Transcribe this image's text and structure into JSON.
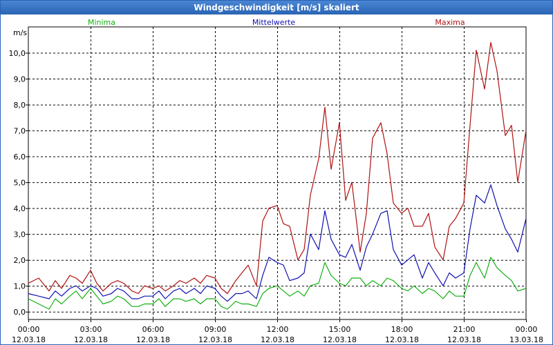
{
  "window": {
    "title": "Windgeschwindigkeit [m/s] skaliert"
  },
  "chart_data": {
    "type": "line",
    "title": "Windgeschwindigkeit [m/s] skaliert",
    "ylabel": "m/s",
    "ylim": [
      -0.3,
      11.0
    ],
    "xlim_hours": [
      0,
      24
    ],
    "y_ticks": [
      "0,0",
      "1,0",
      "2,0",
      "3,0",
      "4,0",
      "5,0",
      "6,0",
      "7,0",
      "8,0",
      "9,0",
      "10,0"
    ],
    "x_ticks": [
      {
        "time": "00:00",
        "date": "12.03.18"
      },
      {
        "time": "03:00",
        "date": "12.03.18"
      },
      {
        "time": "06:00",
        "date": "12.03.18"
      },
      {
        "time": "09:00",
        "date": "12.03.18"
      },
      {
        "time": "12:00",
        "date": "12.03.18"
      },
      {
        "time": "15:00",
        "date": "12.03.18"
      },
      {
        "time": "18:00",
        "date": "12.03.18"
      },
      {
        "time": "21:00",
        "date": "12.03.18"
      },
      {
        "time": "00:00",
        "date": "13.03.18"
      }
    ],
    "grid": true,
    "legend_position": "top",
    "series": [
      {
        "name": "Minima",
        "color": "#10b010",
        "points": [
          [
            0,
            0.5
          ],
          [
            0.5,
            0.3
          ],
          [
            1,
            0.1
          ],
          [
            1.3,
            0.5
          ],
          [
            1.6,
            0.3
          ],
          [
            2,
            0.6
          ],
          [
            2.3,
            0.8
          ],
          [
            2.6,
            0.5
          ],
          [
            3,
            0.9
          ],
          [
            3.3,
            0.6
          ],
          [
            3.6,
            0.3
          ],
          [
            4,
            0.4
          ],
          [
            4.3,
            0.6
          ],
          [
            4.6,
            0.5
          ],
          [
            5,
            0.2
          ],
          [
            5.3,
            0.2
          ],
          [
            5.6,
            0.3
          ],
          [
            6,
            0.3
          ],
          [
            6.3,
            0.5
          ],
          [
            6.6,
            0.2
          ],
          [
            7,
            0.5
          ],
          [
            7.3,
            0.5
          ],
          [
            7.6,
            0.4
          ],
          [
            8,
            0.5
          ],
          [
            8.3,
            0.3
          ],
          [
            8.6,
            0.5
          ],
          [
            9,
            0.5
          ],
          [
            9.3,
            0.2
          ],
          [
            9.6,
            0.1
          ],
          [
            10,
            0.4
          ],
          [
            10.3,
            0.3
          ],
          [
            10.6,
            0.3
          ],
          [
            11,
            0.2
          ],
          [
            11.3,
            0.7
          ],
          [
            11.6,
            0.9
          ],
          [
            12,
            1.0
          ],
          [
            12.3,
            0.8
          ],
          [
            12.6,
            0.6
          ],
          [
            13,
            0.8
          ],
          [
            13.3,
            0.6
          ],
          [
            13.6,
            1.0
          ],
          [
            14,
            1.1
          ],
          [
            14.3,
            1.9
          ],
          [
            14.6,
            1.4
          ],
          [
            15,
            1.1
          ],
          [
            15.3,
            1.0
          ],
          [
            15.6,
            1.3
          ],
          [
            16,
            1.3
          ],
          [
            16.3,
            1.0
          ],
          [
            16.6,
            1.2
          ],
          [
            17,
            1.0
          ],
          [
            17.3,
            1.3
          ],
          [
            17.6,
            1.2
          ],
          [
            18,
            0.9
          ],
          [
            18.3,
            0.8
          ],
          [
            18.6,
            1.0
          ],
          [
            19,
            0.7
          ],
          [
            19.3,
            0.9
          ],
          [
            19.6,
            0.8
          ],
          [
            20,
            0.5
          ],
          [
            20.3,
            0.8
          ],
          [
            20.6,
            0.6
          ],
          [
            21,
            0.6
          ],
          [
            21.3,
            1.4
          ],
          [
            21.6,
            1.9
          ],
          [
            22,
            1.3
          ],
          [
            22.3,
            2.1
          ],
          [
            22.6,
            1.7
          ],
          [
            23,
            1.4
          ],
          [
            23.3,
            1.2
          ],
          [
            23.6,
            0.8
          ],
          [
            24,
            0.9
          ]
        ]
      },
      {
        "name": "Mittelwerte",
        "color": "#1010b0",
        "points": [
          [
            0,
            0.7
          ],
          [
            0.5,
            0.6
          ],
          [
            1,
            0.5
          ],
          [
            1.3,
            0.8
          ],
          [
            1.6,
            0.6
          ],
          [
            2,
            0.9
          ],
          [
            2.3,
            1.0
          ],
          [
            2.6,
            0.8
          ],
          [
            3,
            1.0
          ],
          [
            3.3,
            0.9
          ],
          [
            3.6,
            0.6
          ],
          [
            4,
            0.7
          ],
          [
            4.3,
            0.9
          ],
          [
            4.6,
            0.8
          ],
          [
            5,
            0.5
          ],
          [
            5.3,
            0.5
          ],
          [
            5.6,
            0.6
          ],
          [
            6,
            0.6
          ],
          [
            6.3,
            0.8
          ],
          [
            6.6,
            0.5
          ],
          [
            7,
            0.8
          ],
          [
            7.3,
            0.9
          ],
          [
            7.6,
            0.7
          ],
          [
            8,
            0.9
          ],
          [
            8.3,
            0.7
          ],
          [
            8.6,
            1.0
          ],
          [
            9,
            0.9
          ],
          [
            9.3,
            0.6
          ],
          [
            9.6,
            0.4
          ],
          [
            10,
            0.7
          ],
          [
            10.3,
            0.7
          ],
          [
            10.6,
            0.8
          ],
          [
            11,
            0.5
          ],
          [
            11.3,
            1.4
          ],
          [
            11.6,
            2.1
          ],
          [
            12,
            1.9
          ],
          [
            12.3,
            1.8
          ],
          [
            12.6,
            1.2
          ],
          [
            13,
            1.3
          ],
          [
            13.3,
            1.5
          ],
          [
            13.6,
            3.0
          ],
          [
            14,
            2.4
          ],
          [
            14.3,
            3.9
          ],
          [
            14.6,
            2.8
          ],
          [
            15,
            2.2
          ],
          [
            15.3,
            2.1
          ],
          [
            15.6,
            2.6
          ],
          [
            16,
            1.6
          ],
          [
            16.3,
            2.5
          ],
          [
            16.6,
            3.0
          ],
          [
            17,
            3.8
          ],
          [
            17.3,
            3.9
          ],
          [
            17.6,
            2.4
          ],
          [
            18,
            1.8
          ],
          [
            18.3,
            2.0
          ],
          [
            18.6,
            2.2
          ],
          [
            19,
            1.3
          ],
          [
            19.3,
            1.9
          ],
          [
            19.6,
            1.5
          ],
          [
            20,
            1.0
          ],
          [
            20.3,
            1.5
          ],
          [
            20.6,
            1.3
          ],
          [
            21,
            1.5
          ],
          [
            21.3,
            3.2
          ],
          [
            21.6,
            4.5
          ],
          [
            22,
            4.2
          ],
          [
            22.3,
            4.9
          ],
          [
            22.6,
            4.1
          ],
          [
            23,
            3.2
          ],
          [
            23.3,
            2.8
          ],
          [
            23.6,
            2.3
          ],
          [
            24,
            3.6
          ]
        ]
      },
      {
        "name": "Maxima",
        "color": "#b01010",
        "points": [
          [
            0,
            1.1
          ],
          [
            0.5,
            1.3
          ],
          [
            1,
            0.8
          ],
          [
            1.3,
            1.2
          ],
          [
            1.6,
            0.9
          ],
          [
            2,
            1.4
          ],
          [
            2.3,
            1.3
          ],
          [
            2.6,
            1.1
          ],
          [
            3,
            1.6
          ],
          [
            3.3,
            1.1
          ],
          [
            3.6,
            0.8
          ],
          [
            4,
            1.1
          ],
          [
            4.3,
            1.2
          ],
          [
            4.6,
            1.1
          ],
          [
            5,
            0.8
          ],
          [
            5.3,
            0.7
          ],
          [
            5.6,
            1.0
          ],
          [
            6,
            0.9
          ],
          [
            6.3,
            1.0
          ],
          [
            6.6,
            0.8
          ],
          [
            7,
            1.0
          ],
          [
            7.3,
            1.2
          ],
          [
            7.6,
            1.1
          ],
          [
            8,
            1.3
          ],
          [
            8.3,
            1.1
          ],
          [
            8.6,
            1.4
          ],
          [
            9,
            1.3
          ],
          [
            9.3,
            0.9
          ],
          [
            9.6,
            0.7
          ],
          [
            10,
            1.2
          ],
          [
            10.3,
            1.5
          ],
          [
            10.6,
            1.8
          ],
          [
            11,
            1.0
          ],
          [
            11.3,
            3.5
          ],
          [
            11.6,
            4.0
          ],
          [
            12,
            4.1
          ],
          [
            12.3,
            3.4
          ],
          [
            12.6,
            3.3
          ],
          [
            13,
            2.0
          ],
          [
            13.3,
            2.4
          ],
          [
            13.6,
            4.5
          ],
          [
            14,
            5.9
          ],
          [
            14.3,
            7.9
          ],
          [
            14.6,
            5.5
          ],
          [
            15,
            7.3
          ],
          [
            15.3,
            4.3
          ],
          [
            15.6,
            5.0
          ],
          [
            16,
            2.3
          ],
          [
            16.3,
            3.8
          ],
          [
            16.6,
            6.7
          ],
          [
            17,
            7.3
          ],
          [
            17.3,
            6.1
          ],
          [
            17.6,
            4.2
          ],
          [
            18,
            3.8
          ],
          [
            18.3,
            4.0
          ],
          [
            18.6,
            3.3
          ],
          [
            19,
            3.3
          ],
          [
            19.3,
            3.8
          ],
          [
            19.6,
            2.5
          ],
          [
            20,
            2.0
          ],
          [
            20.3,
            3.3
          ],
          [
            20.6,
            3.6
          ],
          [
            21,
            4.2
          ],
          [
            21.3,
            7.2
          ],
          [
            21.6,
            10.1
          ],
          [
            22,
            8.6
          ],
          [
            22.3,
            10.4
          ],
          [
            22.6,
            9.3
          ],
          [
            23,
            6.8
          ],
          [
            23.3,
            7.2
          ],
          [
            23.6,
            5.0
          ],
          [
            24,
            7.0
          ]
        ]
      }
    ]
  }
}
